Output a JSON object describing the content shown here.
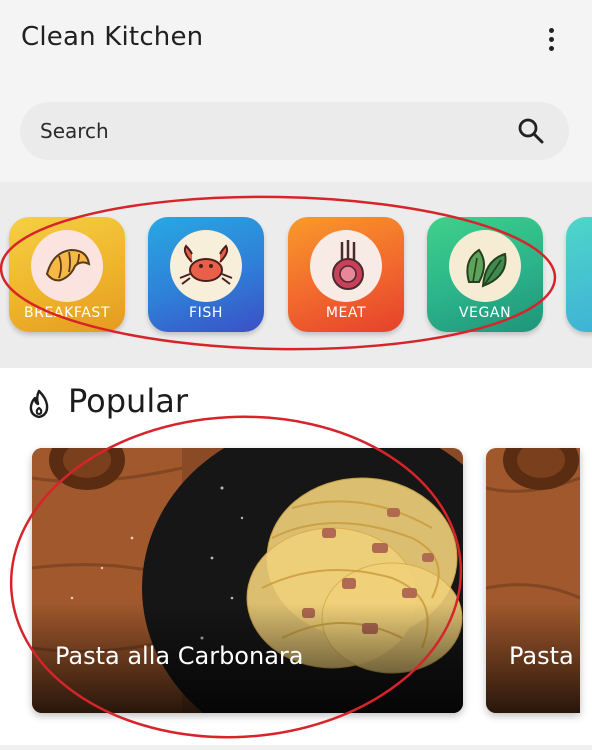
{
  "app": {
    "title": "Clean Kitchen",
    "menu_icon": "more-vert-icon"
  },
  "search": {
    "placeholder": "Search",
    "icon": "search-icon"
  },
  "categories": [
    {
      "label": "BREAKFAST",
      "icon": "croissant-icon",
      "color": "#eeb52b"
    },
    {
      "label": "FISH",
      "icon": "crab-icon",
      "color": "#2f7fd7"
    },
    {
      "label": "MEAT",
      "icon": "lamb-chop-icon",
      "color": "#f2682d"
    },
    {
      "label": "VEGAN",
      "icon": "leaf-icon",
      "color": "#2bb38a"
    }
  ],
  "popular": {
    "icon": "flame-icon",
    "title": "Popular",
    "recipes": [
      {
        "title": "Pasta alla Carbonara"
      },
      {
        "title": "Pasta"
      }
    ]
  },
  "annotation_color": "#d6242a"
}
